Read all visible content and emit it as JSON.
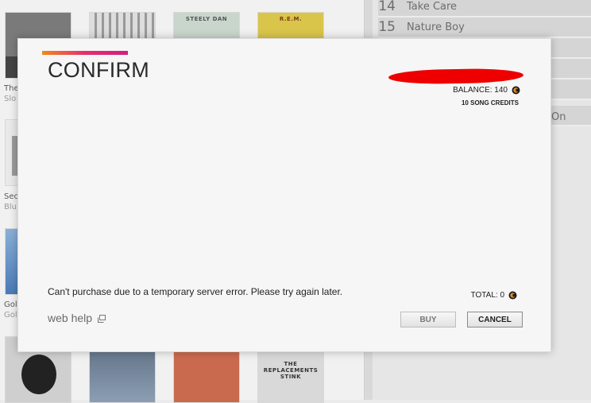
{
  "background": {
    "albums": [
      {
        "label": "The",
        "sub": "Slo",
        "art_text": ""
      },
      {
        "label": "",
        "sub": "",
        "art_text": ""
      },
      {
        "label": "",
        "sub": "",
        "art_text": "STEELY DAN"
      },
      {
        "label": "",
        "sub": "",
        "art_text": "R.E.M."
      },
      {
        "label": "Sec",
        "sub": "Blu",
        "art_text": ""
      },
      {
        "label": "Gol",
        "sub": "Gol",
        "art_text": ""
      },
      {
        "label": "",
        "sub": "",
        "art_text": ""
      },
      {
        "label": "",
        "sub": "",
        "art_text": ""
      },
      {
        "label": "",
        "sub": "",
        "art_text": ""
      },
      {
        "label": "",
        "sub": "",
        "art_text": "THE REPLACEMENTS STINK"
      }
    ],
    "tracks": [
      {
        "num": "14",
        "title": "Take Care"
      },
      {
        "num": "15",
        "title": "Nature Boy"
      }
    ],
    "partial_track_text": "On"
  },
  "dialog": {
    "title": "CONFIRM",
    "balance_label": "BALANCE: 140",
    "song_credits": "10 SONG CREDITS",
    "error_message": "Can't purchase due to a temporary server error. Please try again later.",
    "web_help": "web help",
    "total_label": "TOTAL: 0",
    "buy_label": "BUY",
    "cancel_label": "CANCEL",
    "coin_icon": "coin-icon",
    "external_icon": "external-link-icon"
  },
  "colors": {
    "accent_start": "#f08a1c",
    "accent_end": "#d0207f",
    "redaction": "#ee0000"
  }
}
